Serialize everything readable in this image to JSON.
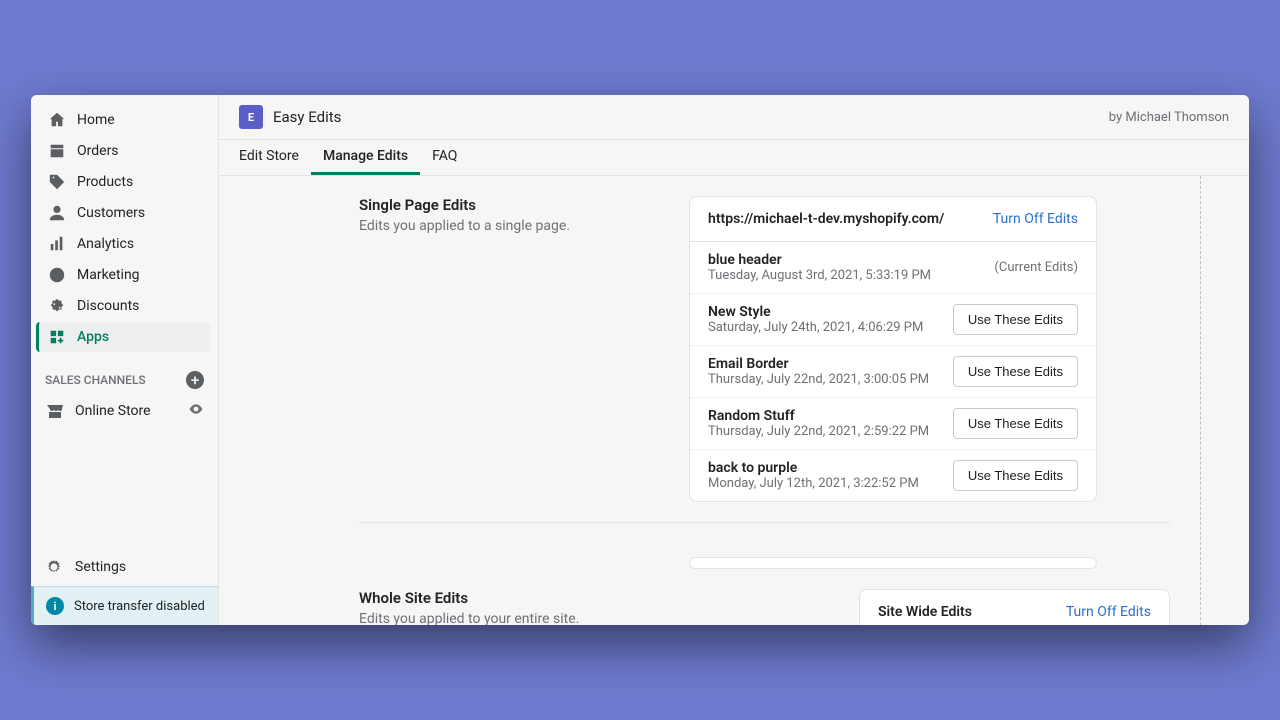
{
  "sidebar": {
    "items": [
      {
        "label": "Home",
        "icon": "home"
      },
      {
        "label": "Orders",
        "icon": "orders"
      },
      {
        "label": "Products",
        "icon": "products"
      },
      {
        "label": "Customers",
        "icon": "customers"
      },
      {
        "label": "Analytics",
        "icon": "analytics"
      },
      {
        "label": "Marketing",
        "icon": "marketing"
      },
      {
        "label": "Discounts",
        "icon": "discounts"
      },
      {
        "label": "Apps",
        "icon": "apps"
      }
    ],
    "sales_channels_header": "SALES CHANNELS",
    "channels": [
      {
        "label": "Online Store",
        "icon": "store"
      }
    ],
    "settings_label": "Settings",
    "info_banner": "Store transfer disabled"
  },
  "app": {
    "title": "Easy Edits",
    "author": "by Michael Thomson",
    "tabs": [
      "Edit Store",
      "Manage Edits",
      "FAQ"
    ],
    "active_tab": 1
  },
  "single_page": {
    "title": "Single Page Edits",
    "desc": "Edits you applied to a single page.",
    "url": "https://michael-t-dev.myshopify.com/",
    "turn_off": "Turn Off Edits",
    "current_tag": "(Current Edits)",
    "use_btn": "Use These Edits",
    "edits": [
      {
        "name": "blue header",
        "date": "Tuesday, August 3rd, 2021, 5:33:19 PM",
        "current": true
      },
      {
        "name": "New Style",
        "date": "Saturday, July 24th, 2021, 4:06:29 PM",
        "current": false
      },
      {
        "name": "Email Border",
        "date": "Thursday, July 22nd, 2021, 3:00:05 PM",
        "current": false
      },
      {
        "name": "Random Stuff",
        "date": "Thursday, July 22nd, 2021, 2:59:22 PM",
        "current": false
      },
      {
        "name": "back to purple",
        "date": "Monday, July 12th, 2021, 3:22:52 PM",
        "current": false
      }
    ]
  },
  "whole_site": {
    "title": "Whole Site Edits",
    "desc": "Edits you applied to your entire site.",
    "card_title": "Site Wide Edits",
    "turn_off": "Turn Off Edits"
  }
}
